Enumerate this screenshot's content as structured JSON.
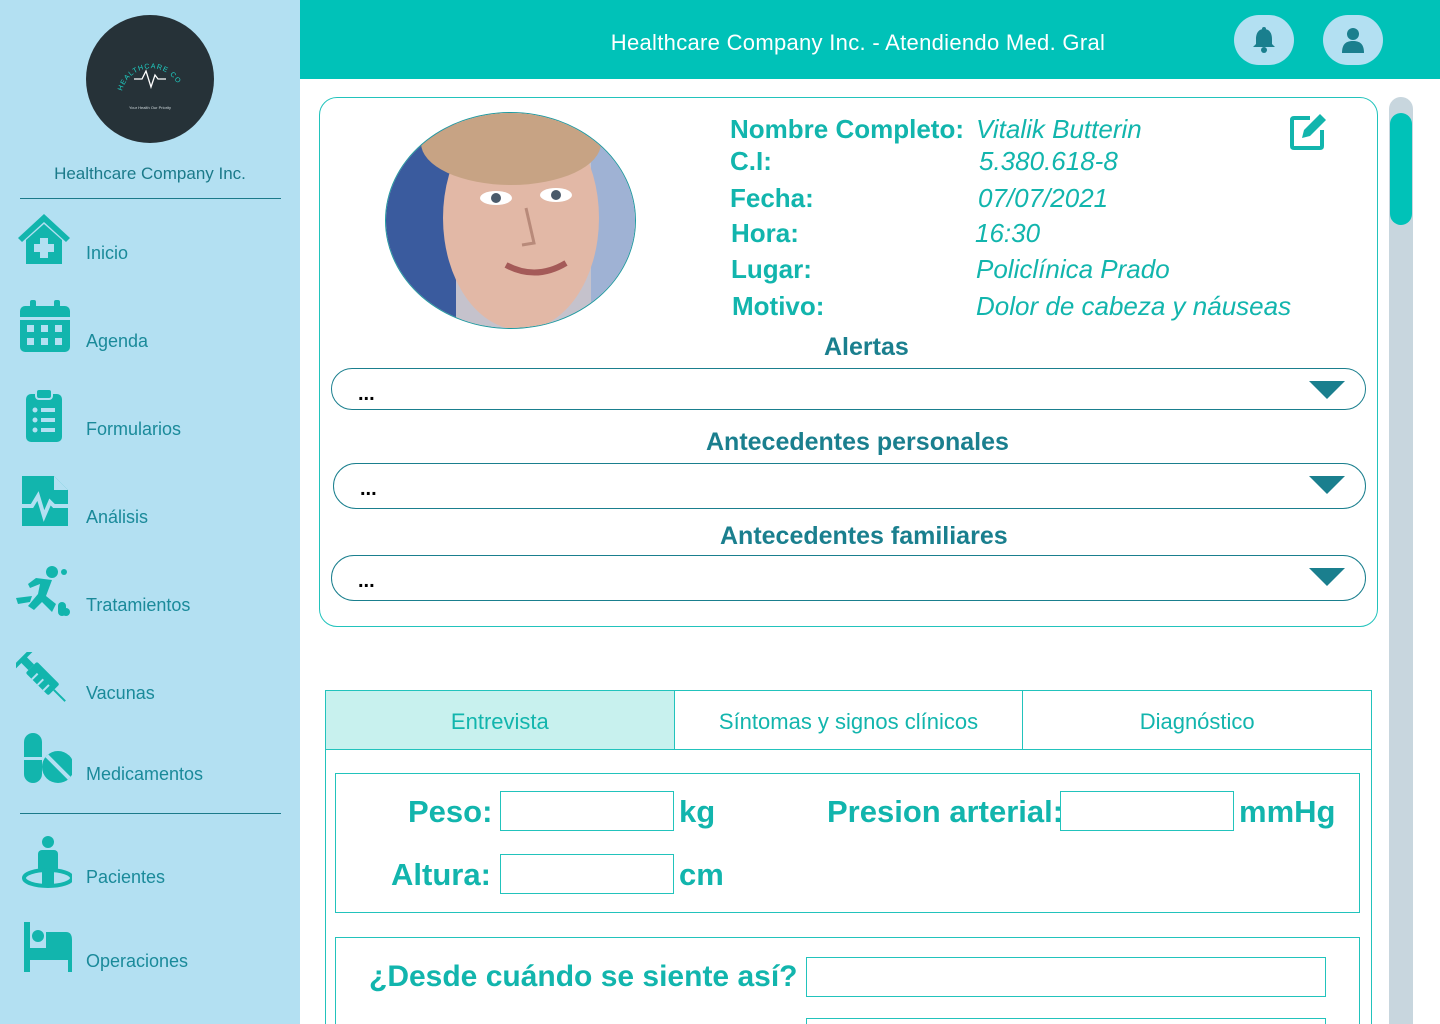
{
  "sidebar": {
    "company": "Healthcare Company Inc.",
    "logo_text": "HEALTHCARE COMPANY",
    "logo_tagline": "Your Health Our Priority",
    "items": [
      {
        "label": "Inicio",
        "icon": "home-medical-icon"
      },
      {
        "label": "Agenda",
        "icon": "calendar-icon"
      },
      {
        "label": "Formularios",
        "icon": "clipboard-list-icon"
      },
      {
        "label": "Análisis",
        "icon": "file-medical-icon"
      },
      {
        "label": "Tratamientos",
        "icon": "running-person-icon"
      },
      {
        "label": "Vacunas",
        "icon": "syringe-icon"
      },
      {
        "label": "Medicamentos",
        "icon": "pills-icon"
      },
      {
        "label": "Pacientes",
        "icon": "patient-icon"
      },
      {
        "label": "Operaciones",
        "icon": "hospital-bed-icon"
      }
    ]
  },
  "header": {
    "title": "Healthcare Company Inc. - Atendiendo Med. Gral",
    "buttons": [
      "bell-icon",
      "user-icon"
    ]
  },
  "patient": {
    "photo": "patient-photo",
    "fields": [
      {
        "label": "Nombre Completo:",
        "value": "Vitalik Butterin"
      },
      {
        "label": "C.I:",
        "value": "5.380.618-8"
      },
      {
        "label": "Fecha:",
        "value": "07/07/2021"
      },
      {
        "label": "Hora:",
        "value": "16:30"
      },
      {
        "label": "Lugar:",
        "value": "Policlínica Prado"
      },
      {
        "label": "Motivo:",
        "value": "Dolor de cabeza y náuseas"
      }
    ]
  },
  "sections": [
    {
      "title": "Alertas",
      "value": "..."
    },
    {
      "title": "Antecedentes personales",
      "value": "..."
    },
    {
      "title": "Antecedentes familiares",
      "value": "..."
    }
  ],
  "tabs": [
    {
      "label": "Entrevista",
      "active": true
    },
    {
      "label": "Síntomas y signos clínicos",
      "active": false
    },
    {
      "label": "Diagnóstico",
      "active": false
    }
  ],
  "vitals": {
    "peso_label": "Peso:",
    "peso_unit": "kg",
    "peso_value": "",
    "altura_label": "Altura:",
    "altura_unit": "cm",
    "altura_value": "",
    "presion_label": "Presion arterial:",
    "presion_unit": "mmHg",
    "presion_value": ""
  },
  "interview": {
    "question1": "¿Desde cuándo se siente así?",
    "answer1": ""
  },
  "colors": {
    "primary": "#00c2b8",
    "sidebar": "#b3e0f2",
    "accent_dark": "#1a7f8e",
    "text": "#12b5ad"
  }
}
